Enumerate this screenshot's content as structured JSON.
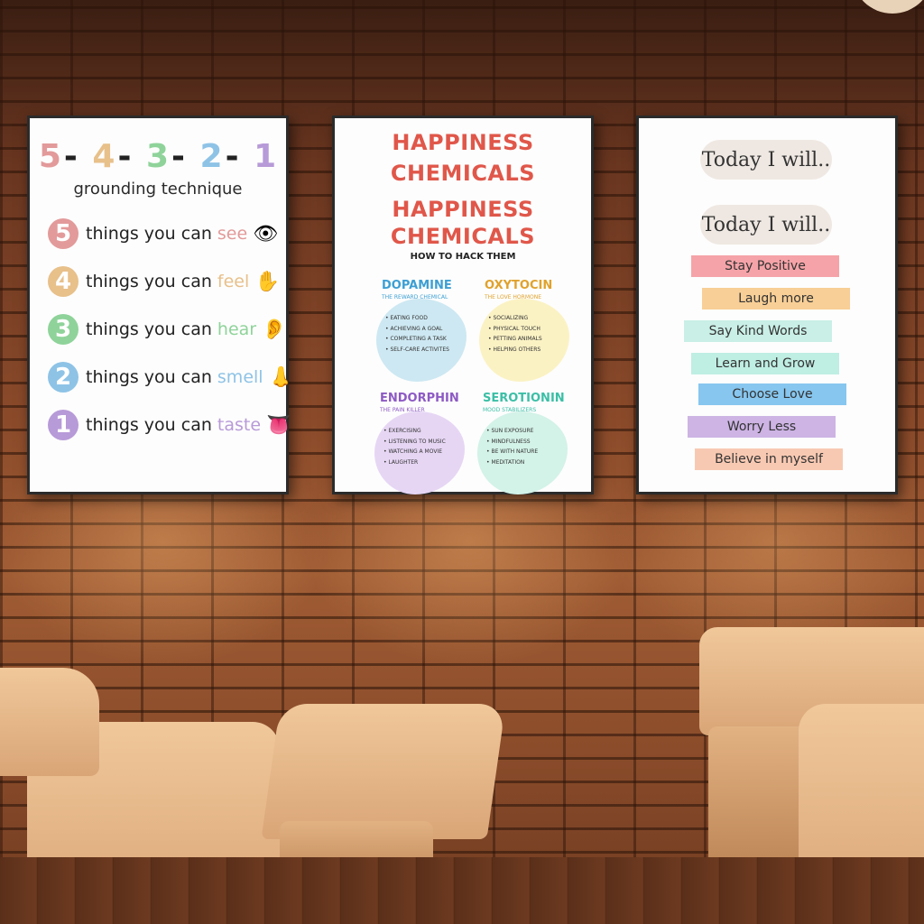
{
  "poster1": {
    "title_digits": [
      "5",
      "4",
      "3",
      "2",
      "1"
    ],
    "title_sep": "-",
    "digit_colors": [
      "#e39a9a",
      "#e8c08a",
      "#8fd39a",
      "#8ec3e6",
      "#b79ad8"
    ],
    "subtitle": "grounding technique",
    "rows": [
      {
        "num": "5",
        "text": "things you can",
        "sense": "see",
        "color": "#e39a9a",
        "icon": "eye-icon",
        "glyph": "👁"
      },
      {
        "num": "4",
        "text": "things you can",
        "sense": "feel",
        "color": "#e8c08a",
        "icon": "hand-icon",
        "glyph": "✋"
      },
      {
        "num": "3",
        "text": "things you can",
        "sense": "hear",
        "color": "#8fd39a",
        "icon": "ear-icon",
        "glyph": "👂"
      },
      {
        "num": "2",
        "text": "things you can",
        "sense": "smell",
        "color": "#8ec3e6",
        "icon": "nose-icon",
        "glyph": "👃"
      },
      {
        "num": "1",
        "text": "things you can",
        "sense": "taste",
        "color": "#b79ad8",
        "icon": "tongue-icon",
        "glyph": "👅"
      }
    ]
  },
  "poster2": {
    "title_line1": "HAPPINESS",
    "title_line2": "CHEMICALS",
    "title_line3": "HAPPINESS",
    "title_line4": "CHEMICALS",
    "subtitle": "HOW TO HACK THEM",
    "chemicals": [
      {
        "name": "DOPAMINE",
        "tag": "THE REWARD CHEMICAL",
        "color": "#3d9fd3",
        "blob": "#cde8f2",
        "items": [
          "EATING FOOD",
          "ACHIEVING A GOAL",
          "COMPLETING A TASK",
          "SELF-CARE ACTIVITES"
        ]
      },
      {
        "name": "OXYTOCIN",
        "tag": "THE LOVE HORMONE",
        "color": "#e0a22c",
        "blob": "#fbf2c4",
        "items": [
          "SOCIALIZING",
          "PHYSICAL TOUCH",
          "PETTING ANIMALS",
          "HELPING OTHERS"
        ]
      },
      {
        "name": "ENDORPHIN",
        "tag": "THE PAIN KILLER",
        "color": "#8d5ac4",
        "blob": "#e6d6f4",
        "items": [
          "EXERCISING",
          "LISTENING TO MUSIC",
          "WATCHING A MOVIE",
          "LAUGHTER"
        ]
      },
      {
        "name": "SEROTIONIN",
        "tag": "MOOD STABILIZERS",
        "color": "#3bbfa6",
        "blob": "#d3f2e8",
        "items": [
          "SUN EXPOSURE",
          "MINDFULNESS",
          "BE WITH NATURE",
          "MEDITATION"
        ]
      }
    ]
  },
  "poster3": {
    "heading1": "Today I will..",
    "heading2": "Today I will..",
    "items": [
      {
        "label": "Stay Positive",
        "color": "#f5a3a8"
      },
      {
        "label": "Laugh more",
        "color": "#f8cf96"
      },
      {
        "label": "Say Kind Words",
        "color": "#c9efe6"
      },
      {
        "label": "Learn and Grow",
        "color": "#bfeee3"
      },
      {
        "label": "Choose Love",
        "color": "#86c6ef"
      },
      {
        "label": "Worry Less",
        "color": "#cdb4e4"
      },
      {
        "label": "Believe in myself",
        "color": "#f8c9b2"
      }
    ]
  }
}
